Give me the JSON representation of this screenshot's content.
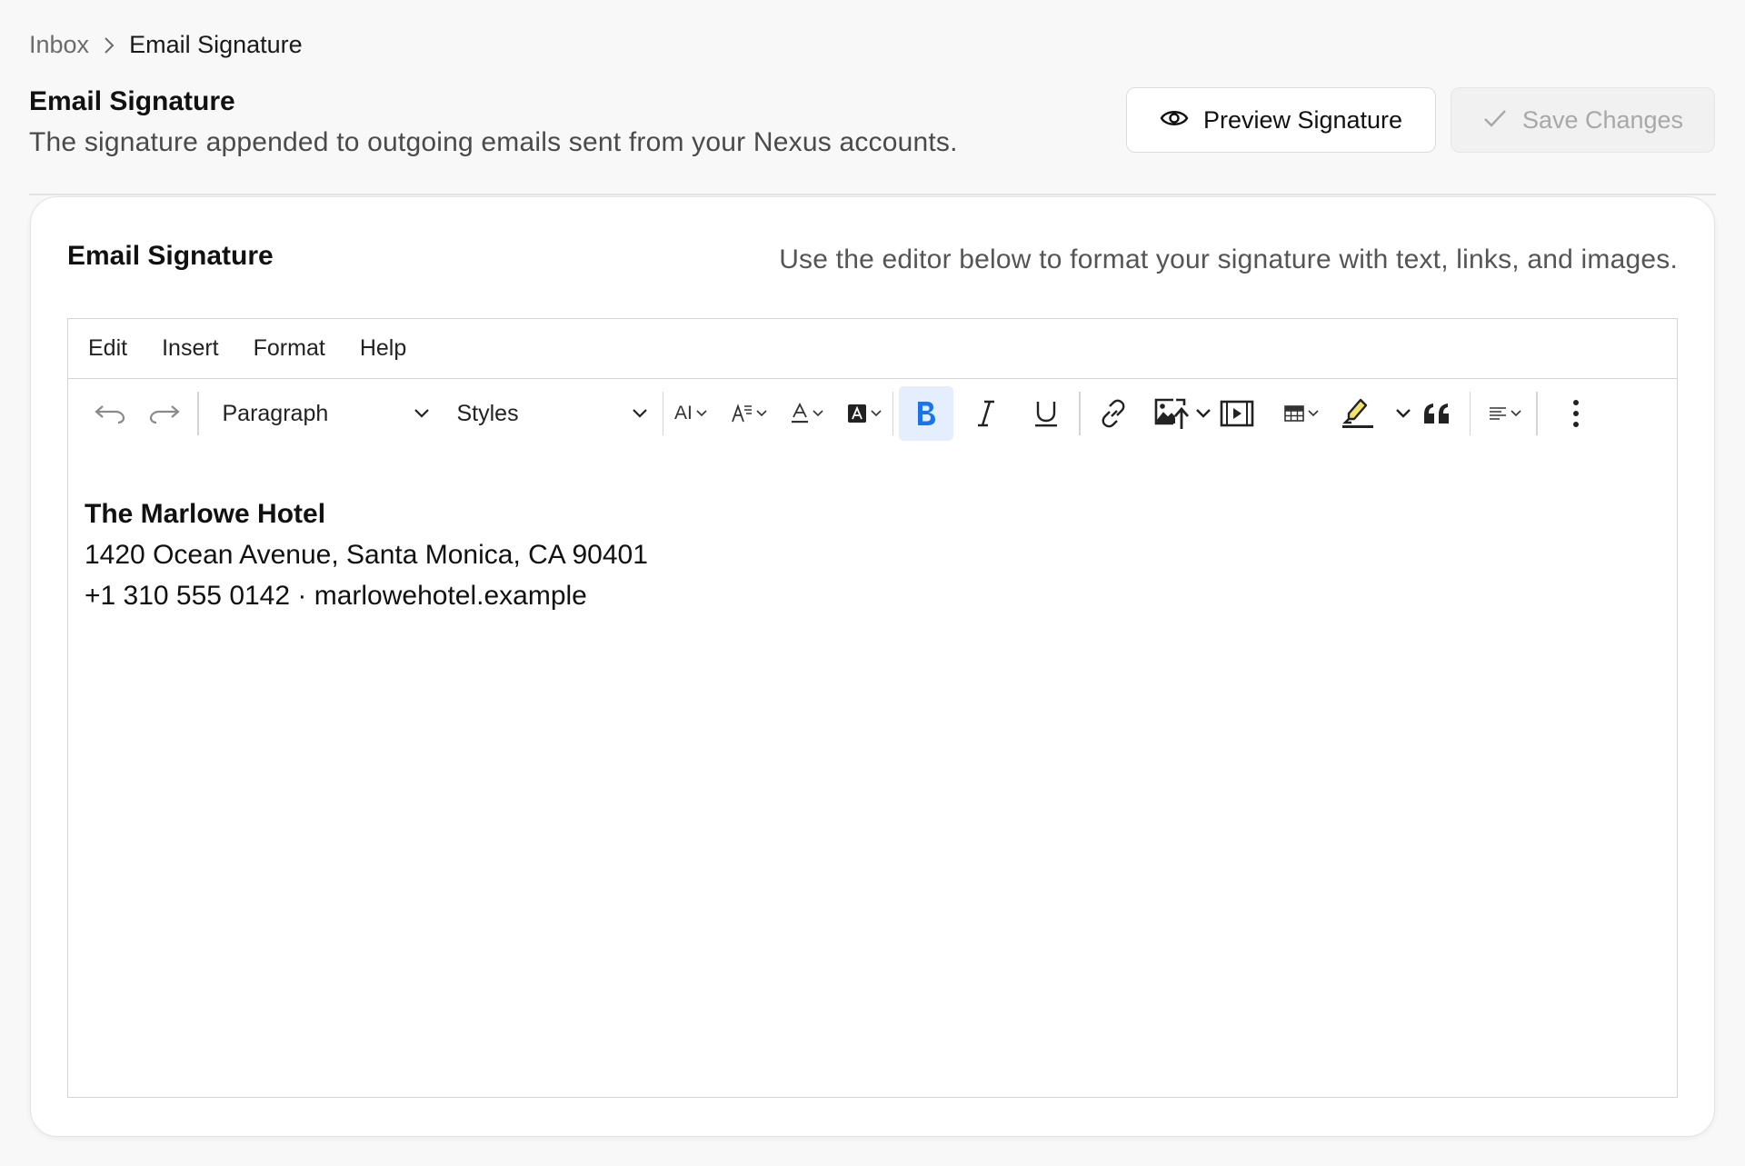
{
  "breadcrumb": {
    "parent": "Inbox",
    "current": "Email Signature"
  },
  "header": {
    "title": "Email Signature",
    "subtitle": "The signature appended to outgoing emails sent from your Nexus accounts.",
    "preview_label": "Preview Signature",
    "save_label": "Save Changes"
  },
  "card": {
    "title": "Email Signature",
    "hint": "Use the editor below to format your signature with text, links, and images."
  },
  "editor": {
    "menu": [
      "Edit",
      "Insert",
      "Format",
      "Help"
    ],
    "block_format": "Paragraph",
    "styles": "Styles",
    "font_family_icon": "AI",
    "content": {
      "line1": "The Marlowe Hotel",
      "line2": "1420 Ocean Avenue, Santa Monica, CA 90401",
      "line3": "+1 310 555 0142 · marlowehotel.example"
    }
  },
  "colors": {
    "accent": "#1a73e8",
    "active_bg": "#e4eefc",
    "highlight": "#f3e36a"
  }
}
